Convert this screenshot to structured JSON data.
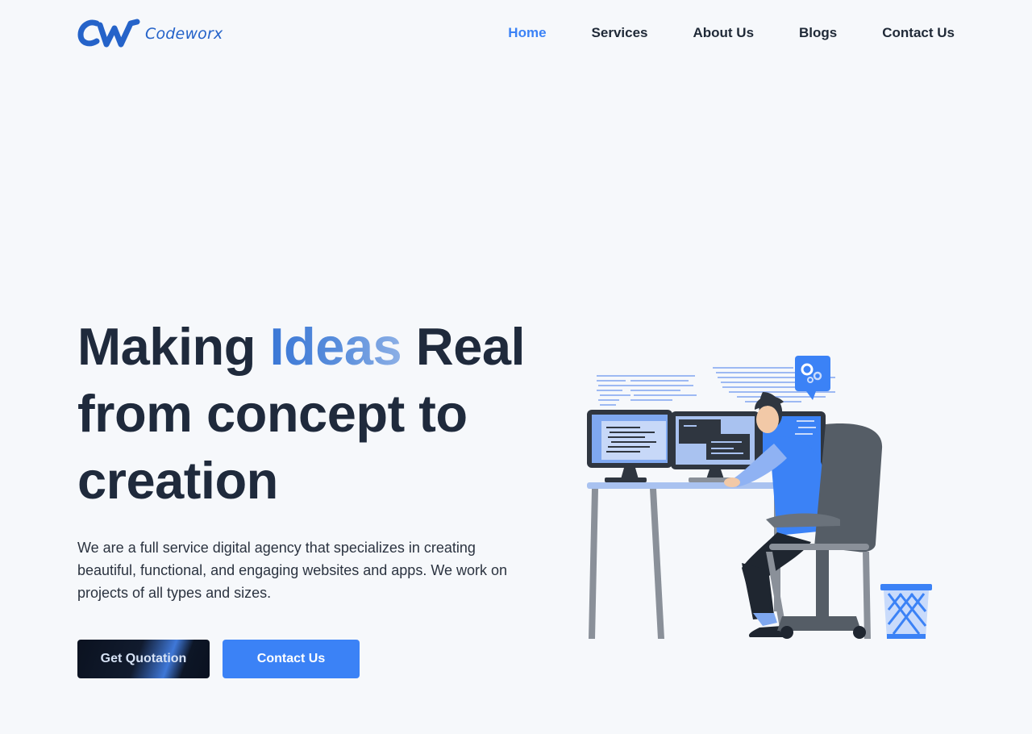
{
  "brand": {
    "logo_mark": "CW",
    "name": "Codeworx"
  },
  "nav": {
    "items": [
      {
        "label": "Home",
        "active": true
      },
      {
        "label": "Services",
        "active": false
      },
      {
        "label": "About Us",
        "active": false
      },
      {
        "label": "Blogs",
        "active": false
      },
      {
        "label": "Contact Us",
        "active": false
      }
    ]
  },
  "hero": {
    "title_part1": "Making ",
    "title_accent": "Ideas",
    "title_part2": " Real from concept to creation",
    "description": "We are a full service digital agency that specializes in creating beautiful, functional, and engaging websites and apps. We work on projects of all types and sizes.",
    "primary_button": "Get Quotation",
    "secondary_button": "Contact Us"
  },
  "illustration": {
    "icon": "developer-at-desk-illustration"
  },
  "colors": {
    "background": "#f6f8fb",
    "accent": "#3b82f6",
    "heading": "#1f2a3c",
    "brand": "#2563c9"
  }
}
